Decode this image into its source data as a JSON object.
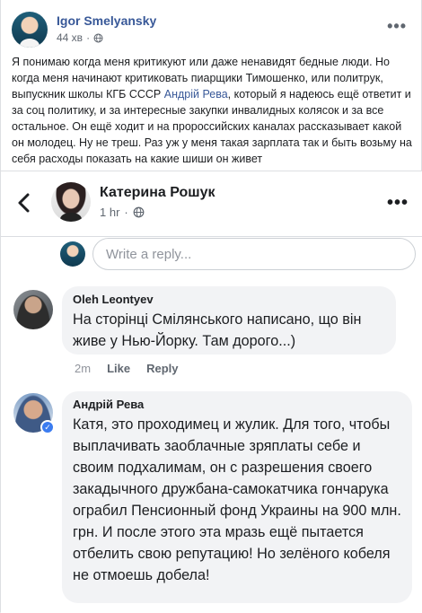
{
  "post": {
    "author": "Igor Smelyansky",
    "time": "44 хв",
    "text_before_link": "Я понимаю когда меня критикуют или даже ненавидят бедные люди. Но когда меня начинают критиковать пиарщики Тимошенко, или политрук, выпускник школы КГБ СССР ",
    "link": "Андрій Рева",
    "text_after_link": ", который я надеюсь ещё ответит и за соц политику, и за интересные закупки инвалидных колясок и за все остальное. Он ещё ходит и на пророссийских каналах рассказывает какой он молодец. Ну не треш. Раз уж у меня такая зарплата так и быть возьму на себя расходы показать на какие шиши он живет",
    "more_icon": "ellipsis-icon",
    "privacy_icon": "globe-icon"
  },
  "viewer": {
    "name": "Катерина Рошук",
    "time": "1 hr",
    "privacy_icon": "globe-icon",
    "back_icon": "back-arrow-icon",
    "more_icon": "ellipsis-icon"
  },
  "reply": {
    "placeholder": "Write a reply..."
  },
  "comments": [
    {
      "name": "Oleh Leontyev",
      "text": "На сторінці Смілянського написано, що він живе у Нью-Йорку. Там дорого...)",
      "time": "2m",
      "like": "Like",
      "reply": "Reply"
    },
    {
      "name": "Андрій Рева",
      "text": "Катя, это проходимец и жулик. Для того, чтобы выплачивать заоблачные зряплаты себе и своим подхалимам, он с разрешения своего закадычного дружбана-самокатчика гончарука ограбил Пенсионный фонд Украины на 900 млн. грн. И после этого эта мразь ещё пытается отбелить свою репутацию! Но зелёного кобеля не отмоешь добела!",
      "verified_icon": "checkmark-icon"
    }
  ],
  "colors": {
    "link": "#385898",
    "bubble": "#f2f3f5",
    "meta": "#606770"
  }
}
